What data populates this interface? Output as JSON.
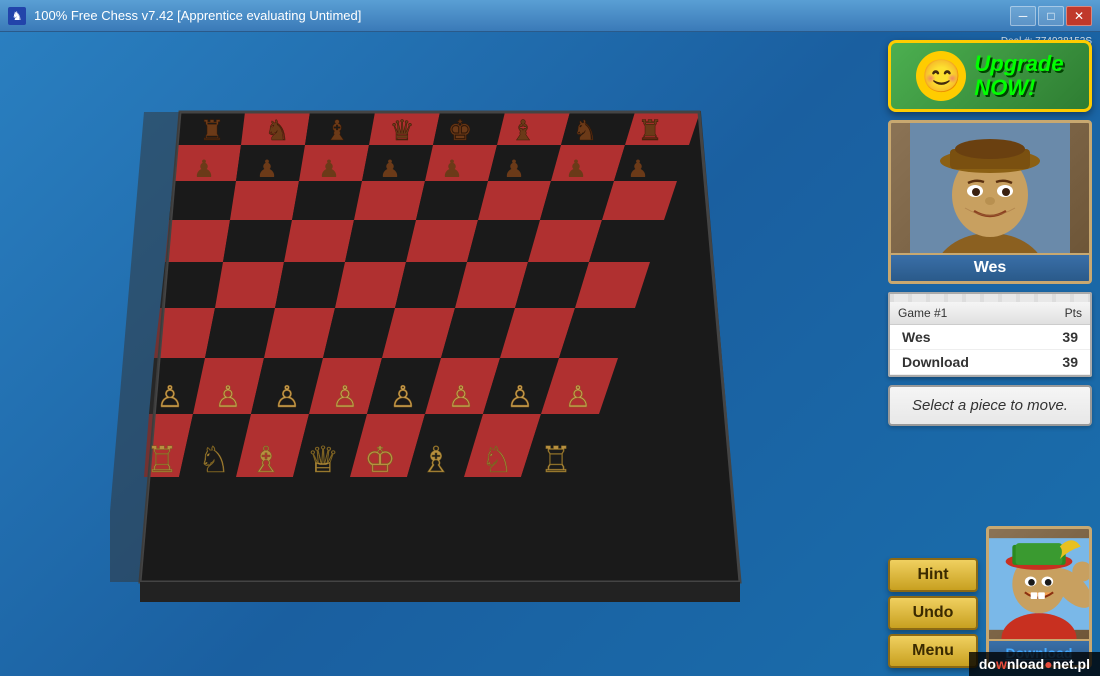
{
  "window": {
    "title": "100% Free Chess v7.42 [Apprentice evaluating Untimed]",
    "minimize_label": "─",
    "maximize_label": "□",
    "close_label": "✕"
  },
  "deal": {
    "label": "Deal #: 774938152S"
  },
  "upgrade": {
    "text_line1": "Upgrade",
    "text_line2": "NOW!",
    "button_label": "Upgrade NOW!"
  },
  "player_top": {
    "name": "Wes"
  },
  "player_bottom": {
    "name": "Download"
  },
  "score": {
    "game_label": "Game #1",
    "pts_label": "Pts",
    "players": [
      {
        "name": "Wes",
        "pts": "39"
      },
      {
        "name": "Download",
        "pts": "39"
      }
    ]
  },
  "status": {
    "message": "Select a piece to move."
  },
  "buttons": {
    "hint": "Hint",
    "undo": "Undo",
    "menu": "Menu"
  },
  "watermark": {
    "prefix": "do",
    "highlight": "w",
    "suffix": "nload",
    "dot": "●",
    "tld": "net.pl"
  }
}
